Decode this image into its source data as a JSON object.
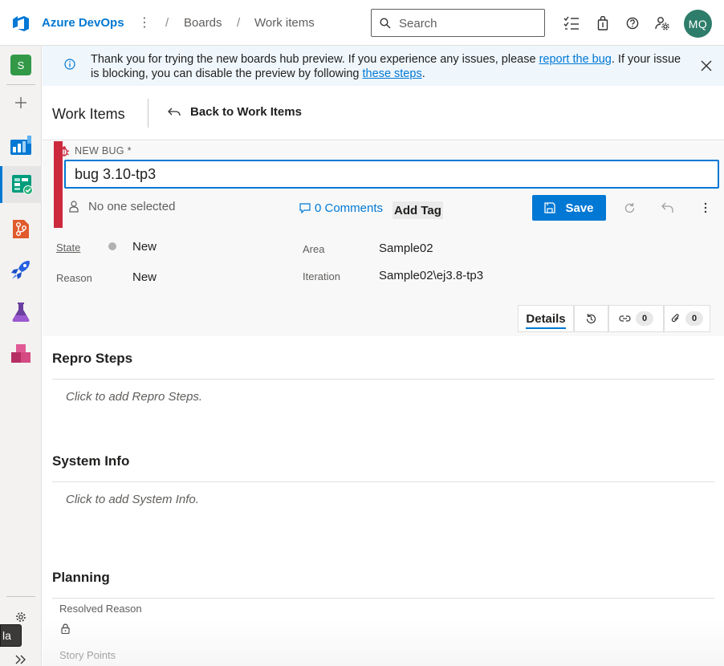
{
  "topbar": {
    "brand": "Azure DevOps",
    "breadcrumb": [
      "Boards",
      "Work items"
    ],
    "search_placeholder": "Search",
    "avatar_initials": "MQ"
  },
  "rail": {
    "project_initial": "S",
    "tooltip_fragment": "la"
  },
  "banner": {
    "text_1": "Thank you for trying the new boards hub preview. If you experience any issues, please ",
    "link_1": "report the bug",
    "text_2": ". If your issue is blocking, you can disable the preview by following ",
    "link_2": "these steps",
    "text_3": "."
  },
  "header": {
    "title": "Work Items",
    "back_label": "Back to Work Items"
  },
  "work_item": {
    "type_label": "NEW BUG *",
    "title": "bug 3.10-tp3",
    "assignee": "No one selected",
    "comments": "0 Comments",
    "add_tag": "Add Tag",
    "save_label": "Save",
    "fields": {
      "state_label": "State",
      "state_value": "New",
      "reason_label": "Reason",
      "reason_value": "New",
      "area_label": "Area",
      "area_value": "Sample02",
      "iteration_label": "Iteration",
      "iteration_value": "Sample02\\ej3.8-tp3"
    },
    "tabs": {
      "details": "Details",
      "links_count": "0",
      "attachments_count": "0"
    }
  },
  "sections": {
    "repro_title": "Repro Steps",
    "repro_placeholder": "Click to add Repro Steps.",
    "sysinfo_title": "System Info",
    "sysinfo_placeholder": "Click to add System Info.",
    "planning_title": "Planning",
    "resolved_reason_label": "Resolved Reason",
    "story_points_label": "Story Points"
  },
  "colors": {
    "accent": "#0078d4",
    "bug_red": "#cc293d",
    "avatar": "#2e7d6b"
  }
}
